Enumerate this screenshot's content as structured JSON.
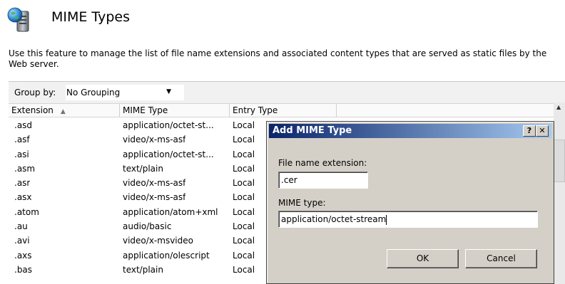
{
  "header": {
    "title": "MIME Types",
    "description": "Use this feature to manage the list of file name extensions and associated content types that are served as static files by the Web server.",
    "icon": "server-globe-icon"
  },
  "groupby": {
    "label": "Group by:",
    "value": "No Grouping"
  },
  "table": {
    "columns": [
      "Extension",
      "MIME Type",
      "Entry Type"
    ],
    "sort_column": "Extension",
    "sort_direction": "ascending",
    "rows": [
      {
        "ext": ".asd",
        "mime": "application/octet-st...",
        "entry": "Local"
      },
      {
        "ext": ".asf",
        "mime": "video/x-ms-asf",
        "entry": "Local"
      },
      {
        "ext": ".asi",
        "mime": "application/octet-st...",
        "entry": "Local"
      },
      {
        "ext": ".asm",
        "mime": "text/plain",
        "entry": "Local"
      },
      {
        "ext": ".asr",
        "mime": "video/x-ms-asf",
        "entry": "Local"
      },
      {
        "ext": ".asx",
        "mime": "video/x-ms-asf",
        "entry": "Local"
      },
      {
        "ext": ".atom",
        "mime": "application/atom+xml",
        "entry": "Local"
      },
      {
        "ext": ".au",
        "mime": "audio/basic",
        "entry": "Local"
      },
      {
        "ext": ".avi",
        "mime": "video/x-msvideo",
        "entry": "Local"
      },
      {
        "ext": ".axs",
        "mime": "application/olescript",
        "entry": "Local"
      },
      {
        "ext": ".bas",
        "mime": "text/plain",
        "entry": "Local"
      }
    ]
  },
  "dialog": {
    "title": "Add MIME Type",
    "help_label": "?",
    "close_label": "✕",
    "extension_label": "File name extension:",
    "extension_value": ".cer",
    "mime_label": "MIME type:",
    "mime_value": "application/octet-stream",
    "ok_label": "OK",
    "cancel_label": "Cancel"
  },
  "colors": {
    "title_bar_start": "#0a246a",
    "title_bar_end": "#a6caf0",
    "dialog_face": "#d4d0c8"
  }
}
